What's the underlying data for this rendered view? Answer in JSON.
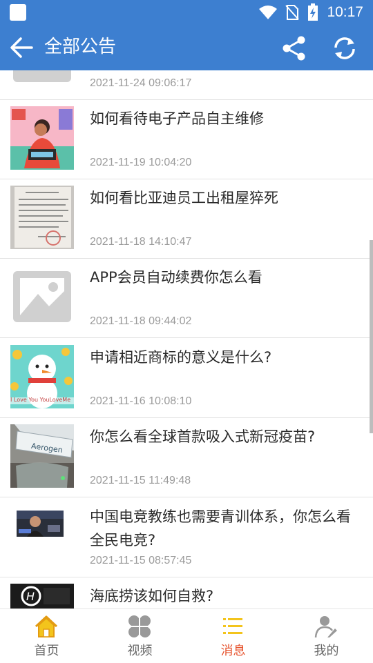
{
  "status_bar": {
    "time": "10:17"
  },
  "header": {
    "title": "全部公告"
  },
  "items": [
    {
      "title": "",
      "date": "2021-11-24 09:06:17"
    },
    {
      "title": "如何看待电子产品自主维修",
      "date": "2021-11-19 10:04:20"
    },
    {
      "title": "如何看比亚迪员工出租屋猝死",
      "date": "2021-11-18 14:10:47"
    },
    {
      "title": "APP会员自动续费你怎么看",
      "date": "2021-11-18 09:44:02"
    },
    {
      "title": "申请相近商标的意义是什么?",
      "date": "2021-11-16 10:08:10",
      "thumb_text": "I Love You YouLoveMe"
    },
    {
      "title": "你怎么看全球首款吸入式新冠疫苗?",
      "date": "2021-11-15 11:49:48",
      "thumb_text": "Aerogen"
    },
    {
      "title": "中国电竞教练也需要青训体系，你怎么看全民电竞?",
      "date": "2021-11-15 08:57:45"
    },
    {
      "title": "海底捞该如何自救?",
      "date": ""
    }
  ],
  "tabs": [
    {
      "label": "首页",
      "icon": "home-icon"
    },
    {
      "label": "视频",
      "icon": "clover-icon"
    },
    {
      "label": "消息",
      "icon": "list-icon",
      "active": true
    },
    {
      "label": "我的",
      "icon": "user-icon"
    }
  ],
  "colors": {
    "primary": "#3d7fd0",
    "active_tab": "#e6502a",
    "home_icon": "#f3c41c"
  }
}
